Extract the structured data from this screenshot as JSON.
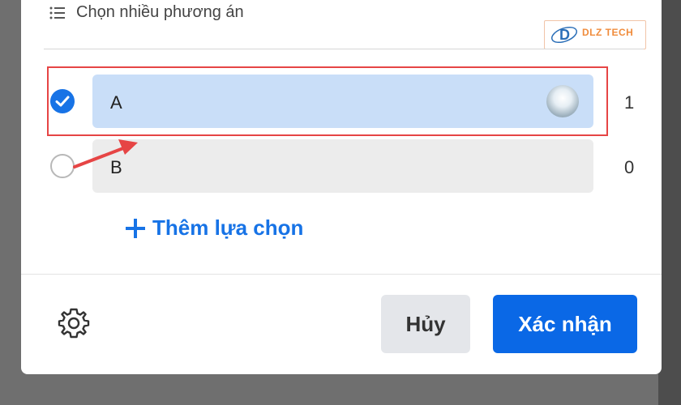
{
  "header": {
    "multi_choice_label": "Chọn nhiều phương án",
    "list_icon": "list-icon"
  },
  "watermark": {
    "brand": "DLZ TECH"
  },
  "options": [
    {
      "label": "A",
      "count": "1",
      "selected": true,
      "has_voter_avatar": true
    },
    {
      "label": "B",
      "count": "0",
      "selected": false,
      "has_voter_avatar": false
    }
  ],
  "add_option": {
    "label": "Thêm lựa chọn",
    "icon": "plus-icon"
  },
  "footer": {
    "settings_icon": "gear-icon",
    "cancel_label": "Hủy",
    "confirm_label": "Xác nhận"
  },
  "colors": {
    "accent": "#1773e6",
    "confirm_button": "#0a68e6",
    "selected_option_bg": "#c9def8",
    "annotation_red": "#e64545"
  }
}
